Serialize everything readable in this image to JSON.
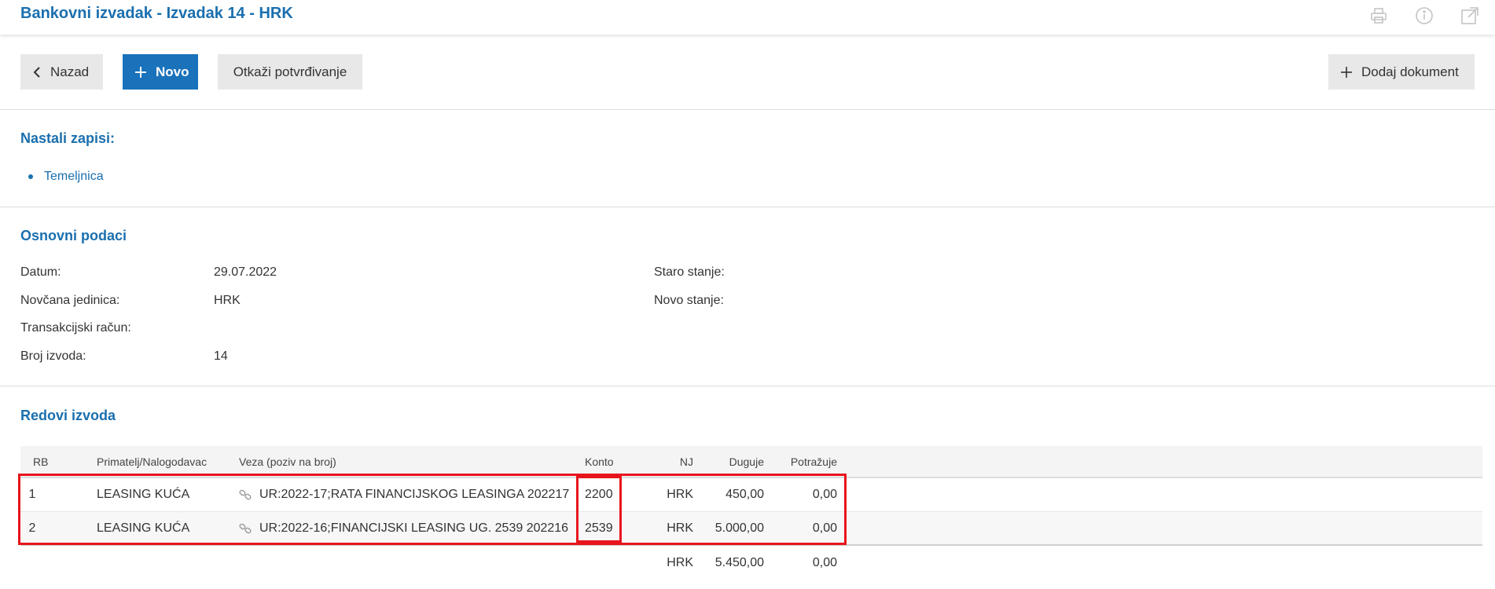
{
  "header": {
    "title": "Bankovni izvadak - Izvadak 14 - HRK",
    "icons": [
      "printer-icon",
      "info-icon",
      "external-window-icon"
    ]
  },
  "toolbar": {
    "back_label": "Nazad",
    "new_label": "Novo",
    "cancel_label": "Otkaži potvrđivanje",
    "add_doc_label": "Dodaj dokument"
  },
  "records": {
    "title": "Nastali zapisi:",
    "items": [
      "Temeljnica"
    ]
  },
  "basic": {
    "title": "Osnovni podaci",
    "datum_label": "Datum:",
    "datum_value": "29.07.2022",
    "valuta_label": "Novčana jedinica:",
    "valuta_value": "HRK",
    "racun_label": "Transakcijski račun:",
    "racun_value": "",
    "broj_label": "Broj izvoda:",
    "broj_value": "14",
    "staro_label": "Staro stanje:",
    "staro_value": "",
    "novo_label": "Novo stanje:",
    "novo_value": ""
  },
  "rows": {
    "title": "Redovi izvoda",
    "columns": [
      "RB",
      "Primatelj/Nalogodavac",
      "Veza (poziv na broj)",
      "Konto",
      "NJ",
      "Duguje",
      "Potražuje"
    ],
    "items": [
      {
        "rb": "1",
        "primatelj": "LEASING KUĆA",
        "veza": "UR:2022-17;RATA FINANCIJSKOG LEASINGA 202217",
        "konto": "2200",
        "nj": "HRK",
        "duguje": "450,00",
        "potrazuje": "0,00"
      },
      {
        "rb": "2",
        "primatelj": "LEASING KUĆA",
        "veza": "UR:2022-16;FINANCIJSKI LEASING UG. 2539 202216",
        "konto": "2539",
        "nj": "HRK",
        "duguje": "5.000,00",
        "potrazuje": "0,00"
      }
    ],
    "totals": {
      "nj": "HRK",
      "duguje": "5.450,00",
      "potrazuje": "0,00"
    }
  },
  "colors": {
    "accent": "#1a6fae",
    "primary_button": "#1a72bb",
    "highlight": "#e8141c"
  }
}
